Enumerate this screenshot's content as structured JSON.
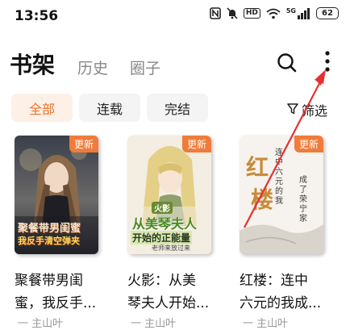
{
  "status_bar": {
    "time": "13:56",
    "hd_label": "HD",
    "signal_label": "5G",
    "battery": "62"
  },
  "header": {
    "tabs": [
      "书架",
      "历史",
      "圈子"
    ],
    "active_tab": "书架"
  },
  "filters": {
    "chips": [
      "全部",
      "连载",
      "完结"
    ],
    "active": "全部",
    "filter_label": "筛选"
  },
  "books": [
    {
      "title_line1": "聚餐带男闺",
      "title_line2": "蜜，我反手...",
      "badge": "更新",
      "cover_text": [
        "聚餐带男闺蜜",
        "我反手清空弹夹"
      ],
      "meta": "一 主山叶"
    },
    {
      "title_line1": "火影：从美",
      "title_line2": "琴夫人开始...",
      "badge": "更新",
      "cover_text": [
        "火影",
        "从美琴夫人",
        "开始的正能量",
        "老师来放过来"
      ],
      "meta": "一 主山叶"
    },
    {
      "title_line1": "红楼：连中",
      "title_line2": "六元的我成...",
      "badge": "更新",
      "cover_text": [
        "红",
        "楼",
        "连中六元的我",
        "成了荣宁家"
      ],
      "meta": "一 主山叶"
    }
  ],
  "colors": {
    "accent": "#e8742d",
    "badge": "#f07b3a",
    "arrow": "#e53030"
  }
}
